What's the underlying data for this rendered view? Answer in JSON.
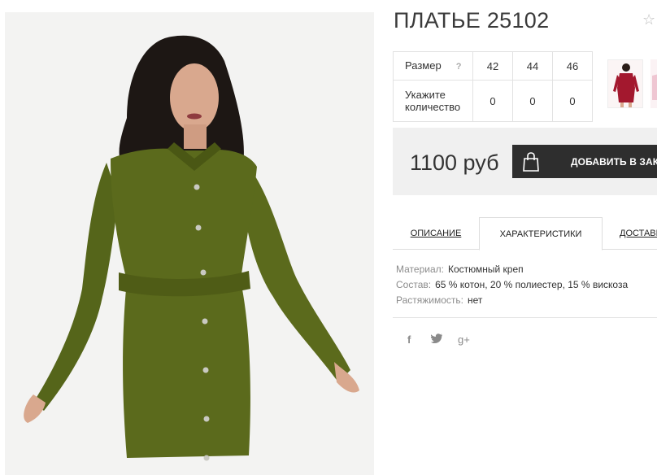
{
  "product": {
    "title": "ПЛАТЬЕ 25102",
    "favorite_icon": "star-icon"
  },
  "sizes": {
    "size_label": "Размер",
    "help_icon": "question-icon",
    "help_glyph": "?",
    "sizes": [
      "42",
      "44",
      "46"
    ],
    "qty_label_line1": "Укажите",
    "qty_label_line2": "количество",
    "quantities": [
      "0",
      "0",
      "0"
    ]
  },
  "gallery": {
    "main_image": "green-dress-photo",
    "thumbnails": [
      "red-dress-thumbnail",
      "pink-dress-thumbnail"
    ]
  },
  "purchase": {
    "price": "1100 руб",
    "cart_icon": "shopping-bag-icon",
    "add_to_cart_label": "ДОБАВИТЬ В ЗАКАЗ"
  },
  "tabs": [
    {
      "label": "ОПИСАНИЕ",
      "active": false
    },
    {
      "label": "ХАРАКТЕРИСТИКИ",
      "active": true
    },
    {
      "label": "ДОСТАВКА",
      "active": false
    }
  ],
  "specs": [
    {
      "key": "Материал:",
      "value": "Костюмный креп"
    },
    {
      "key": "Состав:",
      "value": "65 % котон, 20 % полиестер, 15 % вискоза"
    },
    {
      "key": "Растяжимость:",
      "value": "нет"
    }
  ],
  "social": {
    "facebook": "f",
    "twitter": "twitter-icon",
    "googleplus": "g+"
  },
  "colors": {
    "dress": "#5b6a1c",
    "button": "#2e2e2e",
    "price_bg": "#f0f0f0",
    "red_dress": "#a3182e"
  }
}
